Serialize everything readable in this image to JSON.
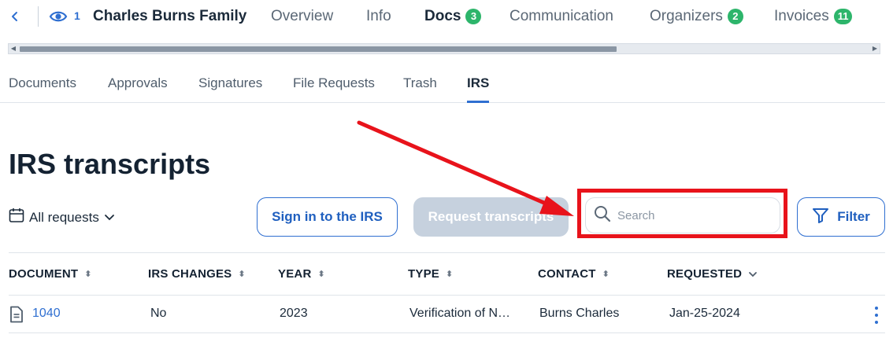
{
  "header": {
    "back_icon": "chevron-left-icon",
    "viewer_icon": "eye-icon",
    "viewer_count": "1",
    "client_name": "Charles Burns Family",
    "tabs": [
      {
        "label": "Overview",
        "badge": ""
      },
      {
        "label": "Info",
        "badge": ""
      },
      {
        "label": "Docs",
        "badge": "3"
      },
      {
        "label": "Communication",
        "badge": ""
      },
      {
        "label": "Organizers",
        "badge": "2"
      },
      {
        "label": "Invoices",
        "badge": "11"
      }
    ]
  },
  "subtabs": [
    {
      "label": "Documents"
    },
    {
      "label": "Approvals"
    },
    {
      "label": "Signatures"
    },
    {
      "label": "File Requests"
    },
    {
      "label": "Trash"
    },
    {
      "label": "IRS"
    }
  ],
  "page": {
    "title": "IRS transcripts"
  },
  "toolbar": {
    "requests_filter_label": "All requests",
    "sign_in_label": "Sign in to the IRS",
    "request_label": "Request transcripts",
    "search_placeholder": "Search",
    "filter_label": "Filter"
  },
  "table": {
    "columns": [
      {
        "label": "DOCUMENT",
        "sort": "both"
      },
      {
        "label": "IRS CHANGES",
        "sort": "both"
      },
      {
        "label": "YEAR",
        "sort": "both"
      },
      {
        "label": "TYPE",
        "sort": "both"
      },
      {
        "label": "CONTACT",
        "sort": "both"
      },
      {
        "label": "REQUESTED",
        "sort": "desc"
      }
    ],
    "rows": [
      {
        "document": "1040",
        "irs_changes": "No",
        "year": "2023",
        "type": "Verification of N…",
        "contact": "Burns Charles",
        "requested": "Jan-25-2024"
      }
    ]
  },
  "colors": {
    "accent": "#2f6fd1",
    "badge": "#2db56b",
    "annotation": "#e8131b"
  }
}
